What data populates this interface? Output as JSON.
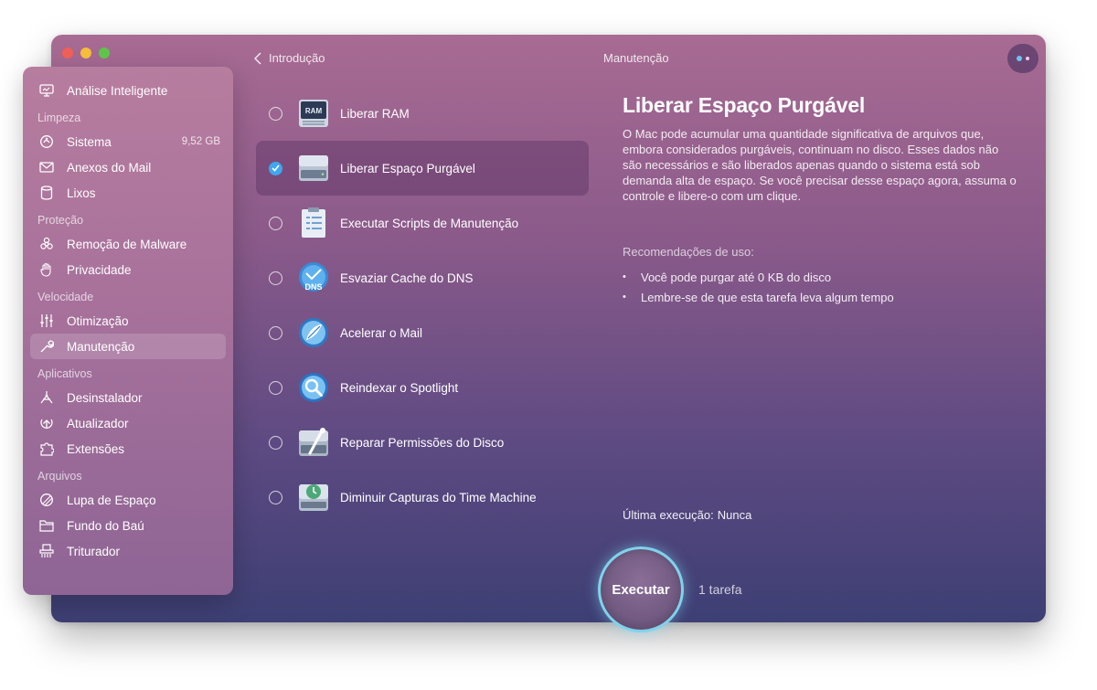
{
  "window": {
    "title": "Manutenção",
    "back_label": "Introdução"
  },
  "sidebar": {
    "top_item": {
      "label": "Análise Inteligente",
      "icon": "monitor-icon"
    },
    "sections": [
      {
        "title": "Limpeza",
        "items": [
          {
            "label": "Sistema",
            "value": "9,52 GB",
            "icon": "system-icon"
          },
          {
            "label": "Anexos do Mail",
            "icon": "mail-icon"
          },
          {
            "label": "Lixos",
            "icon": "trash-icon"
          }
        ]
      },
      {
        "title": "Proteção",
        "items": [
          {
            "label": "Remoção de Malware",
            "icon": "biohazard-icon"
          },
          {
            "label": "Privacidade",
            "icon": "hand-icon"
          }
        ]
      },
      {
        "title": "Velocidade",
        "items": [
          {
            "label": "Otimização",
            "icon": "sliders-icon"
          },
          {
            "label": "Manutenção",
            "icon": "wrench-icon",
            "active": true
          }
        ]
      },
      {
        "title": "Aplicativos",
        "items": [
          {
            "label": "Desinstalador",
            "icon": "uninstaller-icon"
          },
          {
            "label": "Atualizador",
            "icon": "updater-icon"
          },
          {
            "label": "Extensões",
            "icon": "extensions-icon"
          }
        ]
      },
      {
        "title": "Arquivos",
        "items": [
          {
            "label": "Lupa de Espaço",
            "icon": "space-lens-icon"
          },
          {
            "label": "Fundo do Baú",
            "icon": "folder-icon"
          },
          {
            "label": "Triturador",
            "icon": "shredder-icon"
          }
        ]
      }
    ]
  },
  "tasks": [
    {
      "label": "Liberar RAM",
      "icon": "ram-icon",
      "checked": false,
      "icon_text": "RAM"
    },
    {
      "label": "Liberar Espaço Purgável",
      "icon": "drive-icon",
      "checked": true
    },
    {
      "label": "Executar Scripts de Manutenção",
      "icon": "clipboard-icon",
      "checked": false
    },
    {
      "label": "Esvaziar Cache do DNS",
      "icon": "dns-icon",
      "checked": false,
      "icon_text": "DNS"
    },
    {
      "label": "Acelerar o Mail",
      "icon": "mail-speed-icon",
      "checked": false
    },
    {
      "label": "Reindexar o Spotlight",
      "icon": "spotlight-icon",
      "checked": false
    },
    {
      "label": "Reparar Permissões do Disco",
      "icon": "disk-repair-icon",
      "checked": false
    },
    {
      "label": "Diminuir Capturas do Time Machine",
      "icon": "time-machine-icon",
      "checked": false
    }
  ],
  "detail": {
    "title": "Liberar Espaço Purgável",
    "description": "O Mac pode acumular uma quantidade significativa de arquivos que, embora considerados purgáveis, continuam no disco. Esses dados não são necessários e são liberados apenas quando o sistema está sob demanda alta de espaço. Se você precisar desse espaço agora, assuma o controle e libere-o com um clique.",
    "recommendations_title": "Recomendações de uso:",
    "recommendations": [
      "Você pode purgar até 0 KB do disco",
      "Lembre-se de que esta tarefa leva algum tempo"
    ],
    "last_run_label": "Última execução:",
    "last_run_value": "Nunca"
  },
  "footer": {
    "run_label": "Executar",
    "task_count": "1 tarefa"
  },
  "colors": {
    "accent": "#3ea7ef",
    "run_ring": "#7fd3ec",
    "menu_dot_1": "#6fc3f2",
    "menu_dot_2": "#f0c8e6"
  }
}
